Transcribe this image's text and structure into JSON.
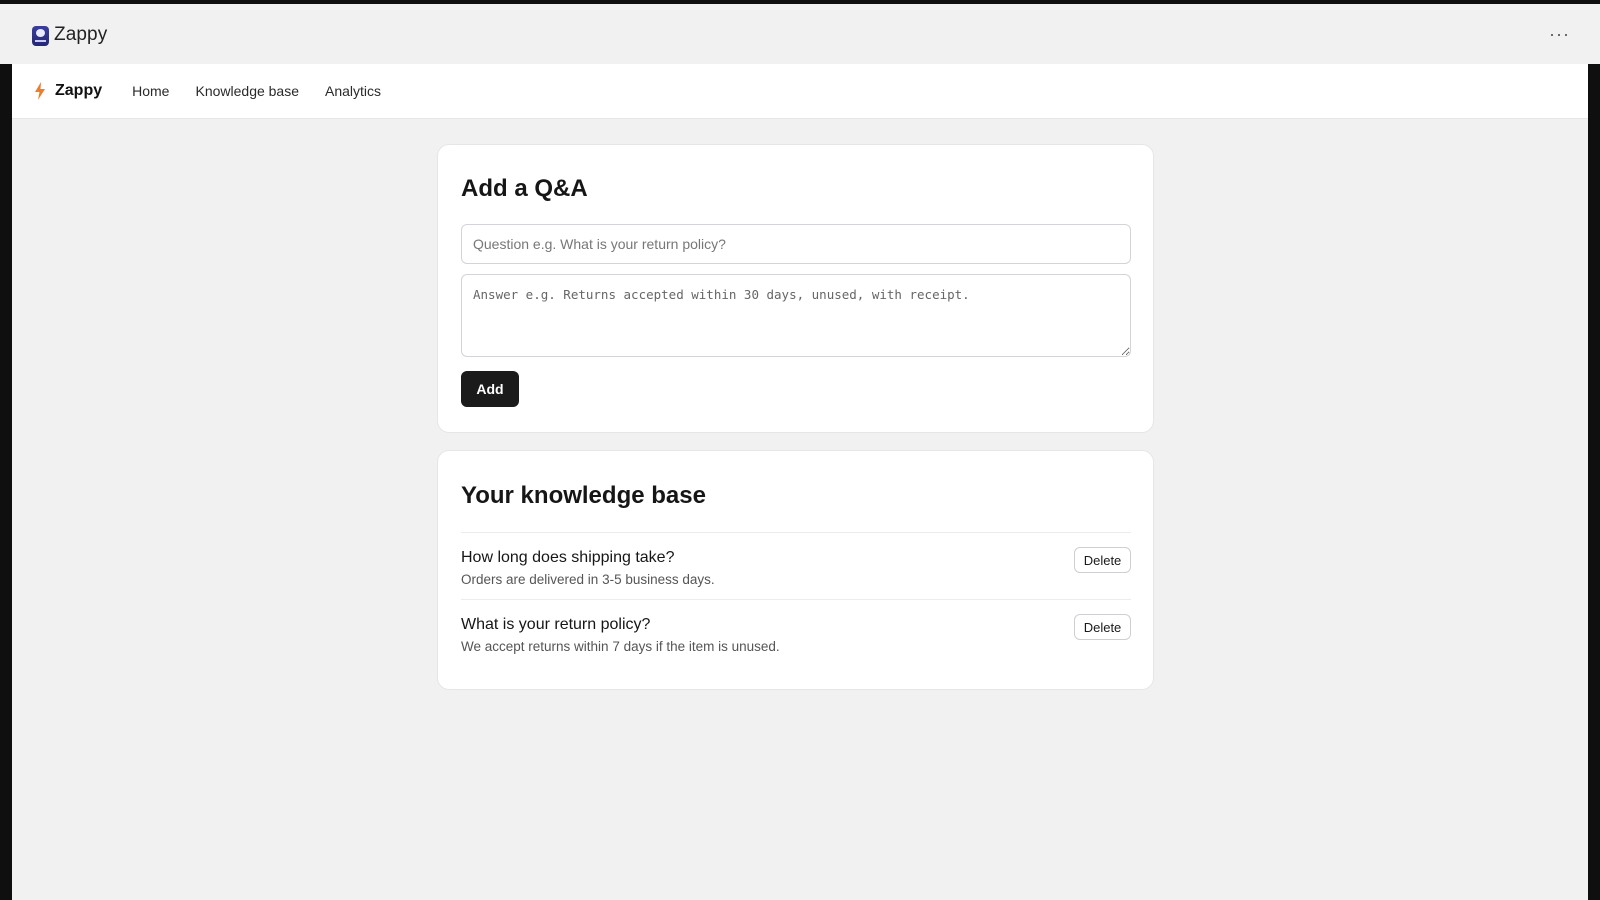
{
  "app": {
    "title": "Zappy",
    "more_menu": "···"
  },
  "nav": {
    "brand": "Zappy",
    "links": [
      "Home",
      "Knowledge base",
      "Analytics"
    ],
    "accent_color": "#f07b2b"
  },
  "add_card": {
    "title": "Add a Q&A",
    "question_placeholder": "Question e.g. What is your return policy?",
    "question_value": "",
    "answer_placeholder": "Answer e.g. Returns accepted within 30 days, unused, with receipt.",
    "answer_value": "",
    "add_label": "Add"
  },
  "kb_card": {
    "title": "Your knowledge base",
    "delete_label": "Delete",
    "items": [
      {
        "question": "How long does shipping take?",
        "answer": "Orders are delivered in 3-5 business days."
      },
      {
        "question": "What is your return policy?",
        "answer": "We accept returns within 7 days if the item is unused."
      }
    ]
  }
}
